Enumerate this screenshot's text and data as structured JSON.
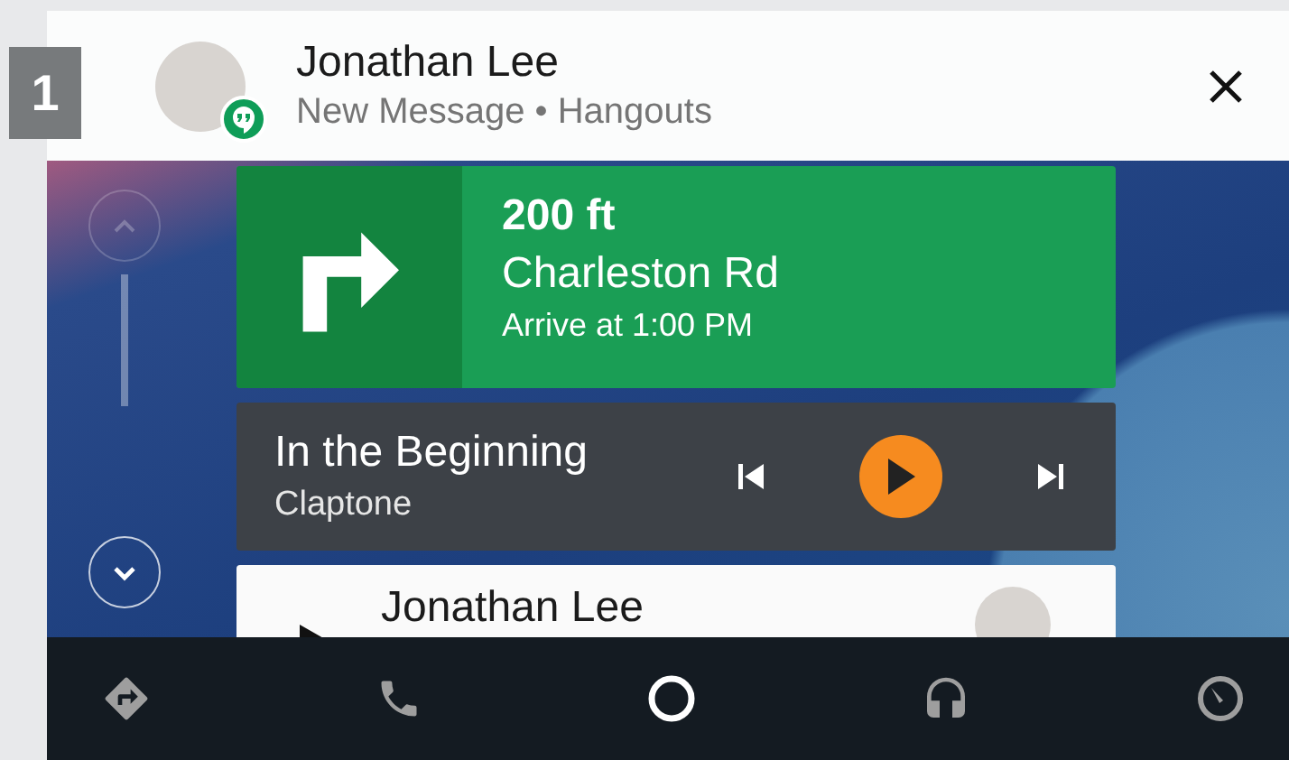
{
  "step_badge": "1",
  "notification": {
    "sender": "Jonathan Lee",
    "subtitle": "New Message • Hangouts"
  },
  "navigation": {
    "distance": "200 ft",
    "street": "Charleston Rd",
    "arrival": "Arrive at 1:00 PM"
  },
  "media": {
    "title": "In the Beginning",
    "artist": "Claptone",
    "playing": false
  },
  "message_card": {
    "sender": "Jonathan Lee"
  },
  "nav_bar": [
    {
      "kind": "directions",
      "selected": false
    },
    {
      "kind": "phone",
      "selected": false
    },
    {
      "kind": "home",
      "selected": true
    },
    {
      "kind": "audio",
      "selected": false
    },
    {
      "kind": "overview",
      "selected": false
    }
  ]
}
